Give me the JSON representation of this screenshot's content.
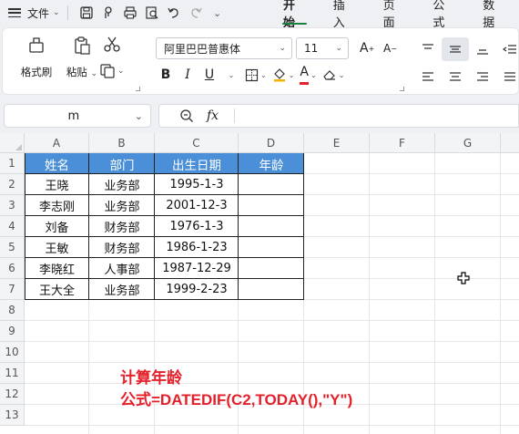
{
  "menubar": {
    "file_label": "文件",
    "tabs": [
      {
        "label": "开始",
        "active": true
      },
      {
        "label": "插入",
        "active": false
      },
      {
        "label": "页面",
        "active": false
      },
      {
        "label": "公式",
        "active": false
      },
      {
        "label": "数据",
        "active": false
      }
    ]
  },
  "ribbon": {
    "format_painter_label": "格式刷",
    "paste_label": "粘贴",
    "font_name": "阿里巴巴普惠体",
    "font_size": "11",
    "bold_label": "B",
    "italic_label": "I",
    "underline_label": "U",
    "font_color_label": "A",
    "grow_label": "A",
    "shrink_label": "A",
    "accent_color": "#1a7f3c",
    "font_color_bar": "#e5202a"
  },
  "formula_bar": {
    "name_box_value": "m",
    "fx_label": "fx",
    "formula_value": ""
  },
  "sheet": {
    "columns": [
      "A",
      "B",
      "C",
      "D",
      "E",
      "F",
      "G"
    ],
    "rows": [
      "1",
      "2",
      "3",
      "4",
      "5",
      "6",
      "7",
      "8",
      "9",
      "10",
      "11",
      "12",
      "13"
    ],
    "header_color": "#4a8fd8",
    "table": {
      "headers": [
        "姓名",
        "部门",
        "出生日期",
        "年龄"
      ],
      "rows": [
        [
          "王晓",
          "业务部",
          "1995-1-3",
          ""
        ],
        [
          "李志刚",
          "业务部",
          "2001-12-3",
          ""
        ],
        [
          "刘备",
          "财务部",
          "1976-1-3",
          ""
        ],
        [
          "王敏",
          "财务部",
          "1986-1-23",
          ""
        ],
        [
          "李晓红",
          "人事部",
          "1987-12-29",
          ""
        ],
        [
          "王大全",
          "业务部",
          "1999-2-23",
          ""
        ]
      ]
    }
  },
  "annotation": {
    "line1": "计算年龄",
    "line2": "公式=DATEDIF(C2,TODAY(),\"Y\")",
    "color": "#e5202a"
  }
}
